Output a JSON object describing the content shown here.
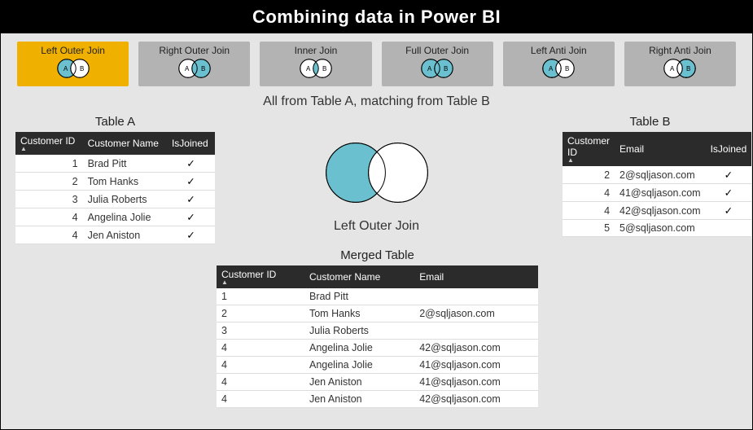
{
  "title": "Combining data in Power BI",
  "join_types": [
    {
      "id": "left-outer",
      "label": "Left Outer Join",
      "selected": true,
      "fill": "left"
    },
    {
      "id": "right-outer",
      "label": "Right Outer Join",
      "selected": false,
      "fill": "right"
    },
    {
      "id": "inner",
      "label": "Inner Join",
      "selected": false,
      "fill": "inner"
    },
    {
      "id": "full-outer",
      "label": "Full Outer Join",
      "selected": false,
      "fill": "both"
    },
    {
      "id": "left-anti",
      "label": "Left Anti Join",
      "selected": false,
      "fill": "left-anti"
    },
    {
      "id": "right-anti",
      "label": "Right Anti Join",
      "selected": false,
      "fill": "right-anti"
    }
  ],
  "description": "All from Table A, matching from Table B",
  "selected_join_label": "Left Outer Join",
  "merged_title": "Merged Table",
  "colors": {
    "accent": "#f0b000",
    "venn_fill": "#6ac0cf"
  },
  "tableA": {
    "title": "Table A",
    "columns": [
      "Customer ID",
      "Customer Name",
      "IsJoined"
    ],
    "rows": [
      {
        "id": "1",
        "name": "Brad Pitt",
        "joined": true
      },
      {
        "id": "2",
        "name": "Tom Hanks",
        "joined": true
      },
      {
        "id": "3",
        "name": "Julia Roberts",
        "joined": true
      },
      {
        "id": "4",
        "name": "Angelina Jolie",
        "joined": true
      },
      {
        "id": "4",
        "name": "Jen Aniston",
        "joined": true
      }
    ]
  },
  "tableB": {
    "title": "Table B",
    "columns": [
      "Customer ID",
      "Email",
      "IsJoined"
    ],
    "rows": [
      {
        "id": "2",
        "email": "2@sqljason.com",
        "joined": true
      },
      {
        "id": "4",
        "email": "41@sqljason.com",
        "joined": true
      },
      {
        "id": "4",
        "email": "42@sqljason.com",
        "joined": true
      },
      {
        "id": "5",
        "email": "5@sqljason.com",
        "joined": false
      }
    ]
  },
  "merged": {
    "columns": [
      "Customer ID",
      "Customer Name",
      "Email"
    ],
    "rows": [
      {
        "id": "1",
        "name": "Brad Pitt",
        "email": ""
      },
      {
        "id": "2",
        "name": "Tom Hanks",
        "email": "2@sqljason.com"
      },
      {
        "id": "3",
        "name": "Julia Roberts",
        "email": ""
      },
      {
        "id": "4",
        "name": "Angelina Jolie",
        "email": "42@sqljason.com"
      },
      {
        "id": "4",
        "name": "Angelina Jolie",
        "email": "41@sqljason.com"
      },
      {
        "id": "4",
        "name": "Jen Aniston",
        "email": "41@sqljason.com"
      },
      {
        "id": "4",
        "name": "Jen Aniston",
        "email": "42@sqljason.com"
      }
    ]
  }
}
